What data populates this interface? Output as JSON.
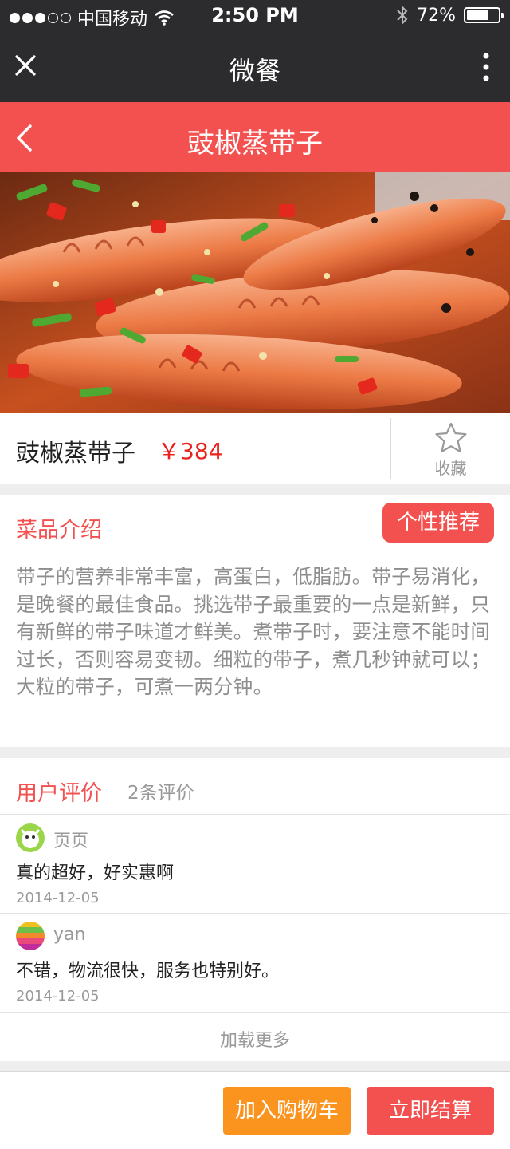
{
  "status_bar": {
    "carrier": "中国移动",
    "time": "2:50 PM",
    "battery": "72%",
    "battery_level": 0.72
  },
  "wechat_bar": {
    "title": "微餐",
    "close_icon": "close-icon",
    "more_icon": "more-vertical-icon"
  },
  "header": {
    "title": "豉椒蒸带子",
    "back_icon": "chevron-left-icon"
  },
  "hero": {
    "image": "shrimp-dish-photo"
  },
  "product": {
    "name": "豉椒蒸带子",
    "price": "￥384",
    "favorite_label": "收藏",
    "favorite_icon": "star-outline-icon"
  },
  "intro": {
    "title": "菜品介绍",
    "recommend_button": "个性推荐",
    "description": "带子的营养非常丰富，高蛋白，低脂肪。带子易消化，是晚餐的最佳食品。挑选带子最重要的一点是新鲜，只有新鲜的带子味道才鲜美。煮带子时，要注意不能时间过长，否则容易变韧。细粒的带子，煮几秒钟就可以；大粒的带子，可煮一两分钟。"
  },
  "reviews": {
    "title": "用户评价",
    "count": "2条评价",
    "items": [
      {
        "user": "页页",
        "text": "真的超好，好实惠啊",
        "date": "2014-12-05"
      },
      {
        "user": "yan",
        "text": "不错，物流很快，服务也特别好。",
        "date": "2014-12-05"
      }
    ],
    "load_more": "加载更多"
  },
  "actions": {
    "add_to_cart": "加入购物车",
    "checkout": "立即结算"
  },
  "colors": {
    "accent_red": "#f3514f",
    "accent_orange": "#fb931f",
    "price_red": "#e8221d",
    "dark_bar": "#2c2c2e"
  }
}
